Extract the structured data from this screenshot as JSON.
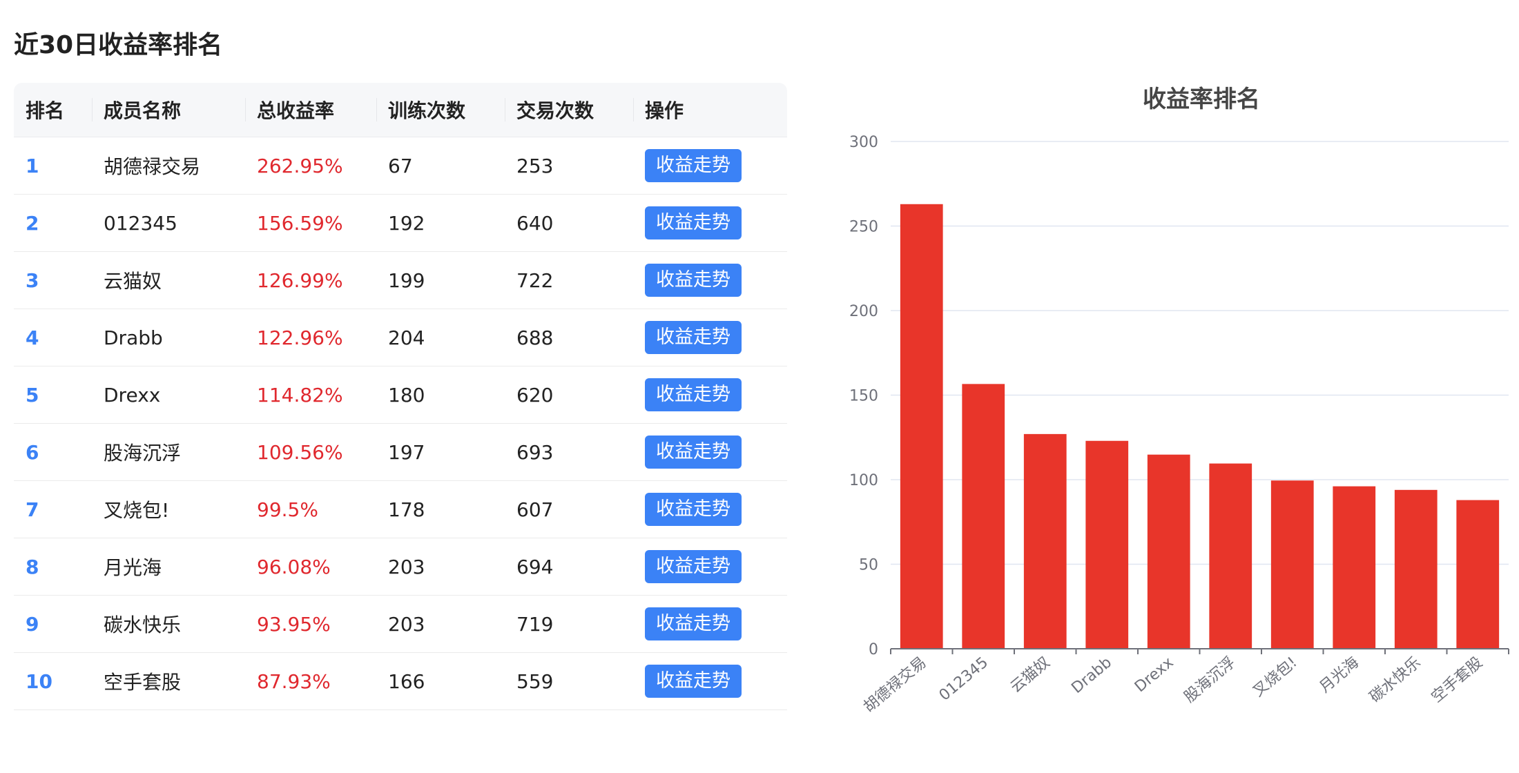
{
  "page": {
    "title": "近30日收益率排名"
  },
  "table": {
    "headers": [
      "排名",
      "成员名称",
      "总收益率",
      "训练次数",
      "交易次数",
      "操作"
    ],
    "rows": [
      {
        "rank": "1",
        "name": "胡德禄交易",
        "rate": "262.95%",
        "trains": "67",
        "trades": "253",
        "action": "收益走势"
      },
      {
        "rank": "2",
        "name": "012345",
        "rate": "156.59%",
        "trains": "192",
        "trades": "640",
        "action": "收益走势"
      },
      {
        "rank": "3",
        "name": "云猫奴",
        "rate": "126.99%",
        "trains": "199",
        "trades": "722",
        "action": "收益走势"
      },
      {
        "rank": "4",
        "name": "Drabb",
        "rate": "122.96%",
        "trains": "204",
        "trades": "688",
        "action": "收益走势"
      },
      {
        "rank": "5",
        "name": "Drexx",
        "rate": "114.82%",
        "trains": "180",
        "trades": "620",
        "action": "收益走势"
      },
      {
        "rank": "6",
        "name": "股海沉浮",
        "rate": "109.56%",
        "trains": "197",
        "trades": "693",
        "action": "收益走势"
      },
      {
        "rank": "7",
        "name": "叉烧包!",
        "rate": "99.5%",
        "trains": "178",
        "trades": "607",
        "action": "收益走势"
      },
      {
        "rank": "8",
        "name": "月光海",
        "rate": "96.08%",
        "trains": "203",
        "trades": "694",
        "action": "收益走势"
      },
      {
        "rank": "9",
        "name": "碳水快乐",
        "rate": "93.95%",
        "trains": "203",
        "trades": "719",
        "action": "收益走势"
      },
      {
        "rank": "10",
        "name": "空手套股",
        "rate": "87.93%",
        "trains": "166",
        "trades": "559",
        "action": "收益走势"
      }
    ]
  },
  "colors": {
    "accent": "#3b82f6",
    "rate": "#e0282e",
    "bar": "#e8352a"
  },
  "chart_data": {
    "type": "bar",
    "title": "收益率排名",
    "categories": [
      "胡德禄交易",
      "012345",
      "云猫奴",
      "Drabb",
      "Drexx",
      "股海沉浮",
      "叉烧包!",
      "月光海",
      "碳水快乐",
      "空手套股"
    ],
    "values": [
      262.95,
      156.59,
      126.99,
      122.96,
      114.82,
      109.56,
      99.5,
      96.08,
      93.95,
      87.93
    ],
    "ylim": [
      0,
      300
    ],
    "yticks": [
      0,
      50,
      100,
      150,
      200,
      250,
      300
    ],
    "grid": true,
    "xlabel": "",
    "ylabel": ""
  }
}
